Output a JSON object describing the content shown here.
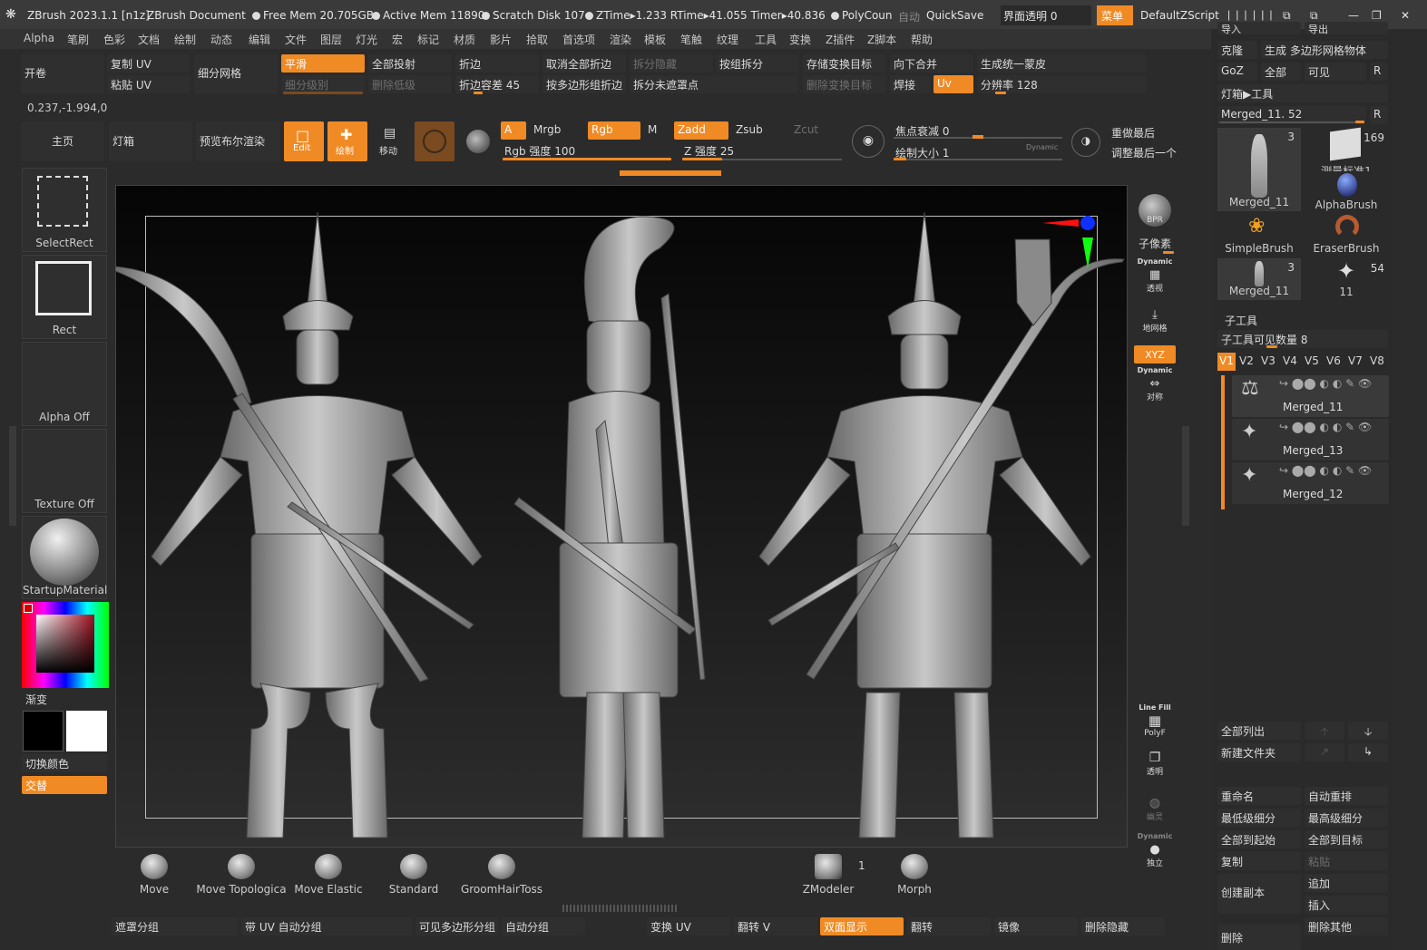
{
  "titlebar": {
    "app": "ZBrush 2023.1.1 [n1z]",
    "document": "ZBrush Document",
    "free_mem": "Free Mem 20.705GB",
    "active_mem": "Active Mem 11890",
    "scratch": "Scratch Disk 107",
    "ztime": "ZTime▸1.233 RTime▸41.055 Timer▸40.836",
    "polycount": "PolyCoun",
    "auto": "自动",
    "quicksave": "QuickSave",
    "ui_transparency": "界面透明 0",
    "menu_btn": "菜单",
    "zscript": "DefaultZScript"
  },
  "menubar": [
    "Alpha",
    "笔刷",
    "色彩",
    "文档",
    "绘制",
    "动态",
    "编辑",
    "文件",
    "图层",
    "灯光",
    "宏",
    "标记",
    "材质",
    "影片",
    "拾取",
    "首选项",
    "渲染",
    "模板",
    "笔触",
    "纹理",
    "工具",
    "变换",
    "Z插件",
    "Z脚本",
    "帮助"
  ],
  "toolbar1": {
    "open": "开卷",
    "copy_uv": "复制 UV",
    "paste_uv": "粘贴 UV",
    "subdivide": "细分网格",
    "smooth": "平滑",
    "sub_level": "细分级别",
    "project_all": "全部投射",
    "del_lower": "删除低级",
    "crease": "折边",
    "crease_tol": "折边容差 45",
    "uncrease_all": "取消全部折边",
    "crease_pg": "按多边形组折边",
    "split_hidden": "拆分隐藏",
    "split_unmasked": "拆分未遮罩点",
    "group_split": "按组拆分",
    "store_morph": "存储变换目标",
    "del_morph": "删除变换目标",
    "merge_down": "向下合并",
    "weld": "焊接",
    "uv": "Uv",
    "unified_skin": "生成统一蒙皮",
    "resolution": "分辨率 128",
    "coords": "0.237,-1.994,0"
  },
  "toolbar2": {
    "home": "主页",
    "lightbox": "灯箱",
    "bool_render": "预览布尔渲染",
    "edit": "Edit",
    "draw": "绘制",
    "move": "移动",
    "a": "A",
    "mrgb": "Mrgb",
    "rgb": "Rgb",
    "m": "M",
    "zadd": "Zadd",
    "zsub": "Zsub",
    "zcut": "Zcut",
    "rgb_intensity": "Rgb 强度 100",
    "z_intensity": "Z 强度 25",
    "focal_shift": "焦点衰减 0",
    "draw_size": "绘制大小 1",
    "dynamic": "Dynamic",
    "redo_last": "重做最后",
    "adjust_last": "调整最后一个",
    "rgb_intensity_value": 100,
    "z_intensity_value": 25
  },
  "leftpanel": {
    "select_rect": "SelectRect",
    "rect": "Rect",
    "alpha_off": "Alpha Off",
    "texture_off": "Texture Off",
    "material": "StartupMaterial",
    "gradient": "渐变",
    "switch_color": "切换颜色",
    "alternate": "交替",
    "main_color": "#000000",
    "secondary_color": "#ffffff"
  },
  "rightstrip": {
    "bpr": "BPR",
    "subpixel": "子像素",
    "dynamic": "Dynamic",
    "persp": "透视",
    "floor": "地网格",
    "xyz": "XYZ",
    "sym": "对称",
    "line_fill": "Line Fill",
    "polyf": "PolyF",
    "transp": "透明",
    "ghost": "幽灵",
    "solo": "独立"
  },
  "brushes": [
    "Move",
    "Move Topologica",
    "Move Elastic",
    "Standard",
    "GroomHairToss"
  ],
  "brushes2": {
    "zmodeler": "ZModeler",
    "zmodeler_count": "1",
    "morph": "Morph"
  },
  "bottombar": [
    "遮罩分组",
    "带 UV 自动分组",
    "可见多边形分组",
    "自动分组",
    "变换 UV",
    "翻转 V",
    "双面显示",
    "翻转",
    "镜像",
    "删除隐藏"
  ],
  "rightpanel": {
    "import": "导入",
    "export": "导出",
    "clone": "克隆",
    "make_polymesh": "生成 多边形网格物体",
    "goz": "GoZ",
    "all": "全部",
    "visible": "可见",
    "r": "R",
    "lightbox_tool": "灯箱▶工具",
    "merged_slider": "Merged_11. 52",
    "tools": [
      {
        "name": "Merged_11",
        "count": "3"
      },
      {
        "name": "测量标准1",
        "count": "169"
      },
      {
        "name": "AlphaBrush",
        "count": ""
      },
      {
        "name": "SimpleBrush",
        "count": ""
      },
      {
        "name": "EraserBrush",
        "count": ""
      },
      {
        "name": "Merged_11",
        "count": "3"
      },
      {
        "name": "11",
        "count": "54"
      }
    ],
    "subtool": "子工具",
    "visible_count": "子工具可见数量 8",
    "v_tabs": [
      "V1",
      "V2",
      "V3",
      "V4",
      "V5",
      "V6",
      "V7",
      "V8"
    ],
    "subtools": [
      "Merged_11",
      "Merged_13",
      "Merged_12"
    ],
    "list_all": "全部列出",
    "new_folder": "新建文件夹",
    "rename": "重命名",
    "auto_reorder": "自动重排",
    "lowest_sub": "最低级细分",
    "highest_sub": "最高级细分",
    "all_to_start": "全部到起始",
    "all_to_target": "全部到目标",
    "duplicate": "复制",
    "paste": "粘贴",
    "create_copy": "创建副本",
    "append": "追加",
    "insert": "插入",
    "delete": "删除",
    "delete_other": "删除其他"
  },
  "colors": {
    "accent": "#f08a24",
    "panel": "#2b2b2b",
    "button": "#2f2f2f"
  }
}
